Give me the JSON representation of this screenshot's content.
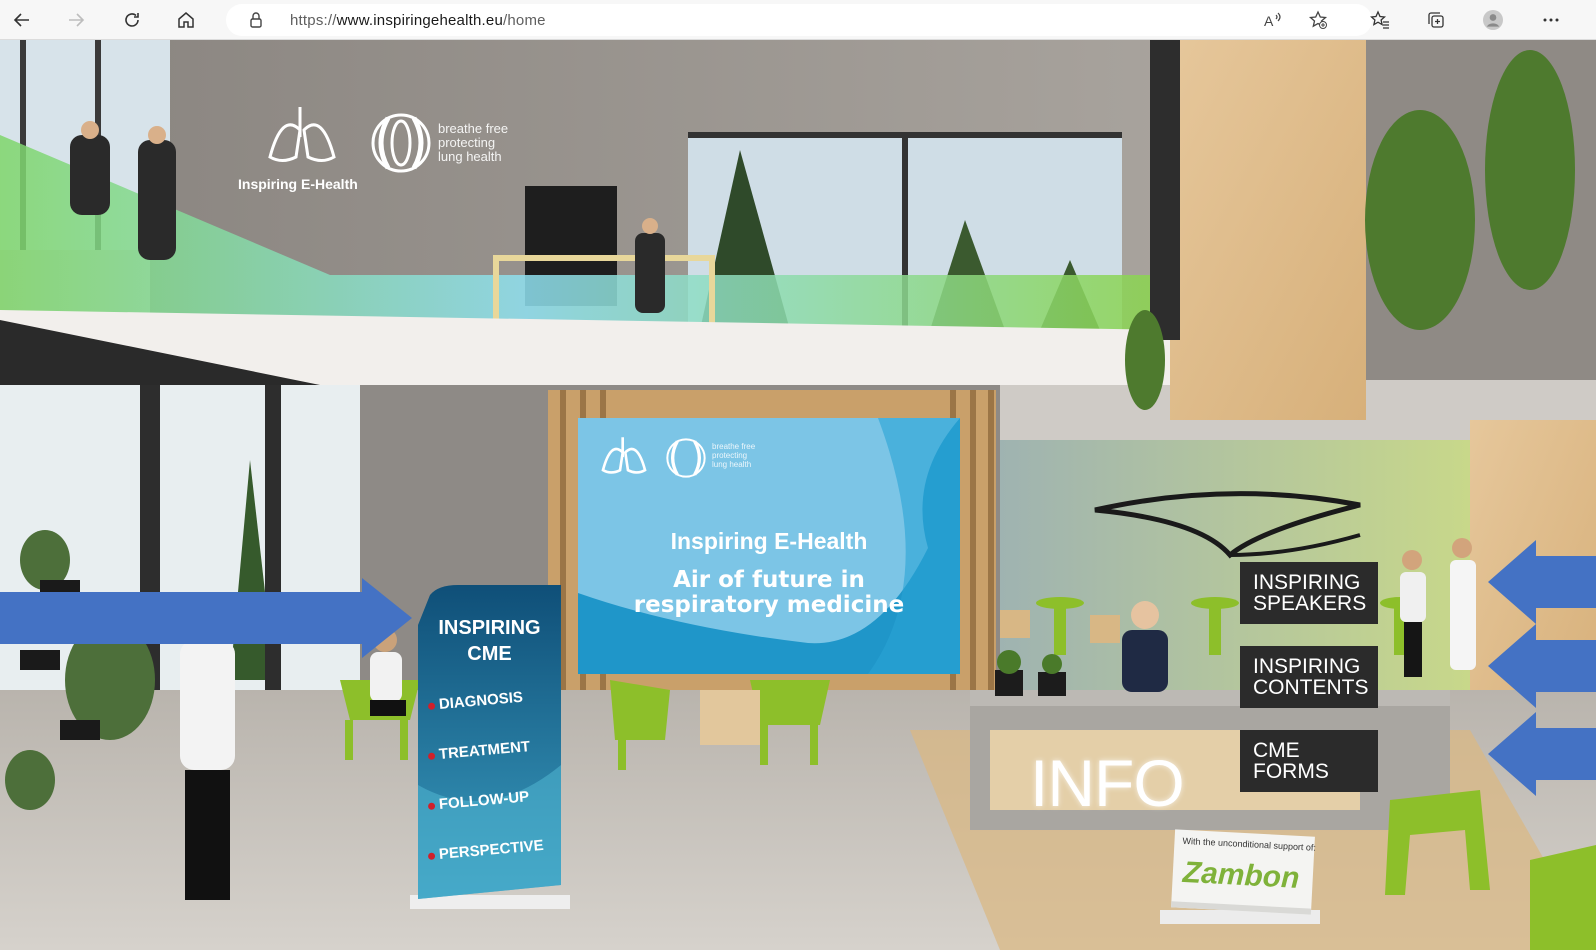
{
  "browser": {
    "url_scheme": "https://",
    "url_host": "www.inspiringehealth.eu",
    "url_path": "/home",
    "icons": [
      "back-arrow-icon",
      "forward-arrow-icon",
      "refresh-icon",
      "home-icon",
      "lock-icon",
      "read-aloud-icon",
      "add-favorite-icon",
      "favorites-icon",
      "collections-icon",
      "profile-icon",
      "more-icon"
    ]
  },
  "branding": {
    "logo_caption": "Inspiring E-Health",
    "tagline": "breathe free\nprotecting\nlung health"
  },
  "screen": {
    "title": "Inspiring E-Health",
    "subtitle": "Air of future in\nrespiratory medicine",
    "tagline": "breathe free\nprotecting\nlung health"
  },
  "totem": {
    "title": "INSPIRING\nCME",
    "items": [
      "DIAGNOSIS",
      "TREATMENT",
      "FOLLOW-UP",
      "PERSPECTIVE"
    ]
  },
  "signs": {
    "speakers": "INSPIRING\nSPEAKERS",
    "contents": "INSPIRING\nCONTENTS",
    "forms": "CME\nFORMS"
  },
  "info_label": "INFO",
  "sponsor": {
    "caption": "With the unconditional support of:",
    "logo": "Zambon"
  },
  "colors": {
    "arrow": "#4472c4",
    "screen_blue": "#1f96c9",
    "totem": "#1d6a8e",
    "sign": "#2b2b2b",
    "chair_green": "#8dbf2a"
  }
}
